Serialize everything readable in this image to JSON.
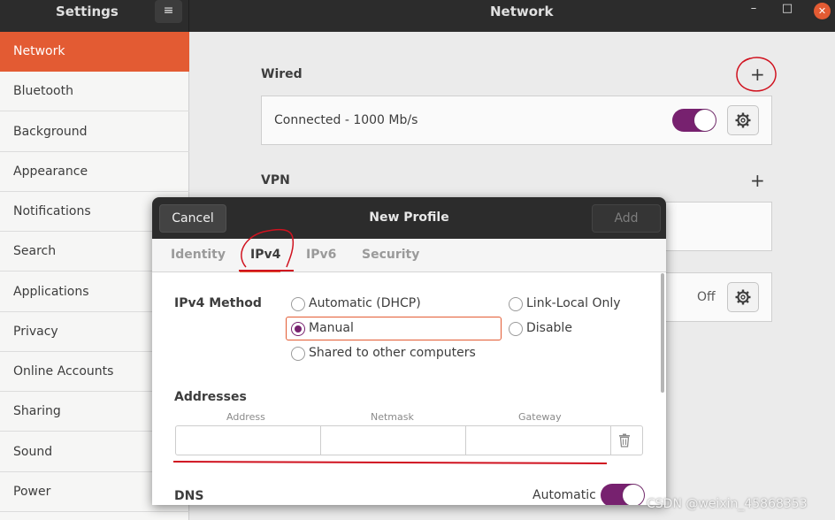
{
  "header": {
    "app_title": "Settings",
    "menu_icon": "≡",
    "search_icon": "⌕",
    "page_title": "Network",
    "minimize": "–",
    "maximize": "□",
    "close": "✕"
  },
  "sidebar": {
    "items": [
      {
        "label": "Network",
        "active": true
      },
      {
        "label": "Bluetooth"
      },
      {
        "label": "Background"
      },
      {
        "label": "Appearance"
      },
      {
        "label": "Notifications"
      },
      {
        "label": "Search"
      },
      {
        "label": "Applications"
      },
      {
        "label": "Privacy"
      },
      {
        "label": "Online Accounts"
      },
      {
        "label": "Sharing"
      },
      {
        "label": "Sound"
      },
      {
        "label": "Power"
      }
    ]
  },
  "main": {
    "wired": {
      "label": "Wired",
      "add": "+",
      "status": "Connected - 1000 Mb/s",
      "toggle_on": true
    },
    "vpn": {
      "label": "VPN",
      "add": "+"
    },
    "proxy": {
      "status": "Off"
    }
  },
  "dialog": {
    "title": "New Profile",
    "cancel": "Cancel",
    "add": "Add",
    "tabs": [
      {
        "label": "Identity"
      },
      {
        "label": "IPv4",
        "active": true
      },
      {
        "label": "IPv6"
      },
      {
        "label": "Security"
      }
    ],
    "ipv4": {
      "method_label": "IPv4 Method",
      "options": {
        "auto": "Automatic (DHCP)",
        "link_local": "Link-Local Only",
        "manual": "Manual",
        "disable": "Disable",
        "shared": "Shared to other computers"
      },
      "selected": "manual",
      "addresses_label": "Addresses",
      "columns": {
        "address": "Address",
        "netmask": "Netmask",
        "gateway": "Gateway"
      },
      "row": {
        "address": "",
        "netmask": "",
        "gateway": ""
      },
      "dns_label": "DNS",
      "dns_auto_label": "Automatic",
      "dns_auto_on": true
    }
  },
  "colors": {
    "accent": "#e35b33",
    "toggle": "#77216f",
    "annotation": "#d0121f"
  },
  "watermark": "CSDN @weixin_45868353"
}
